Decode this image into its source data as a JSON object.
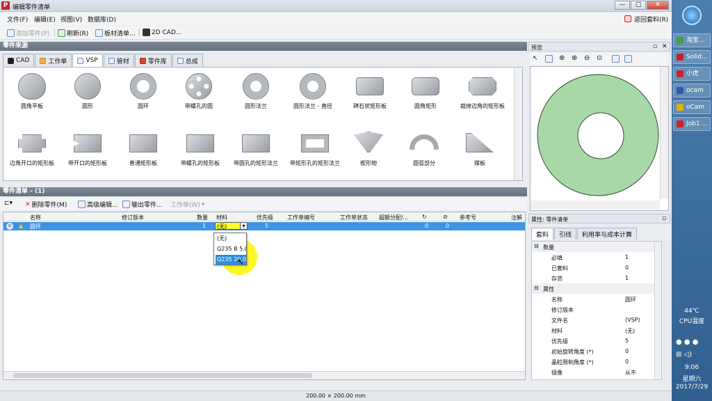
{
  "window": {
    "title": "编辑零件清单",
    "min": "—",
    "max": "▢",
    "close": "✕"
  },
  "menu": {
    "items": [
      "文件(F)",
      "编辑(E)",
      "视图(V)",
      "数据库(D)"
    ],
    "return": "返回套料(R)"
  },
  "toolbar": {
    "add": "添加零件(P)",
    "refresh": "刷新(R)",
    "sheet": "板材清单...",
    "cad": "2D CAD..."
  },
  "source": {
    "title": "零件来源",
    "tabs": [
      "CAD",
      "工作单",
      "VSP",
      "管材",
      "零件库",
      "总成"
    ]
  },
  "parts": [
    {
      "label": "圆角平板"
    },
    {
      "label": "圆形"
    },
    {
      "label": "圆环"
    },
    {
      "label": "带螺孔的圆"
    },
    {
      "label": "圆形法兰"
    },
    {
      "label": "圆形法兰 - 直径"
    },
    {
      "label": "碑石状矩形板"
    },
    {
      "label": "圆角矩形"
    },
    {
      "label": "裁掉边角的矩形板"
    },
    {
      "label": "边角开口的矩形板"
    },
    {
      "label": "带开口的矩形板"
    },
    {
      "label": "普通矩形板"
    },
    {
      "label": "带螺孔的矩形板"
    },
    {
      "label": "带圆孔的矩形法兰"
    },
    {
      "label": "带矩形孔的矩形法兰"
    },
    {
      "label": "楔形物"
    },
    {
      "label": "圆弧部分"
    },
    {
      "label": "撑板"
    }
  ],
  "list": {
    "title": "零件清单 - (1)",
    "toolbar": {
      "delete": "删除零件(M)",
      "advanced": "高级编辑...",
      "export": "输出零件...",
      "worksheet": "工作单(W)"
    },
    "headers": [
      "名称",
      "修订版本",
      "数量",
      "材料",
      "优先级",
      "工作单编号",
      "工作单状态",
      "超额分配/...",
      "参考号",
      "注解"
    ],
    "row": {
      "name": "圆环",
      "qty": "1",
      "material": "(无)",
      "priority": "5",
      "c1": "0",
      "c2": "0"
    },
    "dropdown": [
      "(无)",
      "Q235 B 5.0",
      "Q235 20.00"
    ]
  },
  "preview": {
    "title": "预览"
  },
  "props": {
    "title": "属性: 零件清单",
    "tabs": [
      "套料",
      "引线",
      "利用率与成本计算"
    ],
    "group1": "数量",
    "qty_rows": [
      {
        "k": "必填",
        "v": "1"
      },
      {
        "k": "已套料",
        "v": "0"
      },
      {
        "k": "存货",
        "v": "1"
      }
    ],
    "group2": "属性",
    "attr_rows": [
      {
        "k": "名称",
        "v": "圆环"
      },
      {
        "k": "修订版本",
        "v": ""
      },
      {
        "k": "文件名",
        "v": "(VSP)"
      },
      {
        "k": "材料",
        "v": "(无)"
      },
      {
        "k": "优先级",
        "v": "5"
      },
      {
        "k": "初始旋转角度 (*)",
        "v": "0"
      },
      {
        "k": "晶粒限制角度 (*)",
        "v": "0"
      },
      {
        "k": "镜像",
        "v": "从不"
      }
    ]
  },
  "status": {
    "size": "200.00 × 200.00 mm"
  },
  "taskbar": {
    "items": [
      {
        "label": "淘宝...",
        "color": "#3aa43a"
      },
      {
        "label": "Solid...",
        "color": "#c8242b"
      },
      {
        "label": "小虎",
        "color": "#c8242b"
      },
      {
        "label": "ocam",
        "color": "#2a5db0"
      },
      {
        "label": "oCam",
        "color": "#e0b000"
      },
      {
        "label": "Job1 ...",
        "color": "#c8242b"
      }
    ],
    "temp": "44℃",
    "temp_label": "CPU温度",
    "time": "9:06",
    "weekday": "星期六",
    "date": "2017/7/29"
  }
}
